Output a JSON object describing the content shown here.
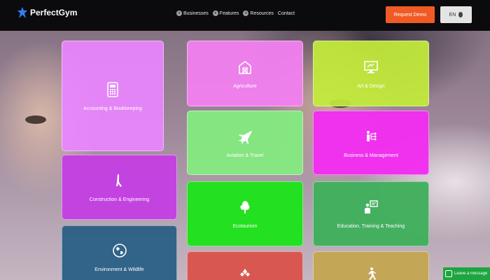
{
  "header": {
    "brand": "PerfectGym",
    "nav": [
      {
        "label": "Businesses",
        "icon": "chevron-down-icon"
      },
      {
        "label": "Features",
        "icon": "chevron-down-icon"
      },
      {
        "label": "Resources",
        "icon": "chevron-down-icon"
      },
      {
        "label": "Contact",
        "icon": ""
      }
    ],
    "demo_button": "Request Demo",
    "language": "EN"
  },
  "cards": [
    {
      "label": "Accounting & Bookkeeping",
      "icon": "calculator-icon",
      "color": "#ea86ff"
    },
    {
      "label": "Agriculture",
      "icon": "barn-icon",
      "color": "#f27ff0"
    },
    {
      "label": "Art & Design",
      "icon": "monitor-icon",
      "color": "#c3ec3a"
    },
    {
      "label": "Aviation & Travel",
      "icon": "airplane-icon",
      "color": "#84ea7f"
    },
    {
      "label": "Business & Management",
      "icon": "org-chart-icon",
      "color": "#f22df0"
    },
    {
      "label": "Construction & Engineering",
      "icon": "crane-icon",
      "color": "#c43ee3"
    },
    {
      "label": "Ecotourism",
      "icon": "tree-icon",
      "color": "#1ee21c"
    },
    {
      "label": "Education, Training & Teaching",
      "icon": "presentation-icon",
      "color": "#41b05d"
    },
    {
      "label": "Environment & Wildlife",
      "icon": "globe-icon",
      "color": "#2a5f85"
    },
    {
      "label": "",
      "icon": "people-icon",
      "color": "#d9554d"
    },
    {
      "label": "",
      "icon": "runner-icon",
      "color": "#c3a553"
    }
  ],
  "chat": {
    "label": "Leave a message",
    "icon": "chat-bubble-icon"
  }
}
